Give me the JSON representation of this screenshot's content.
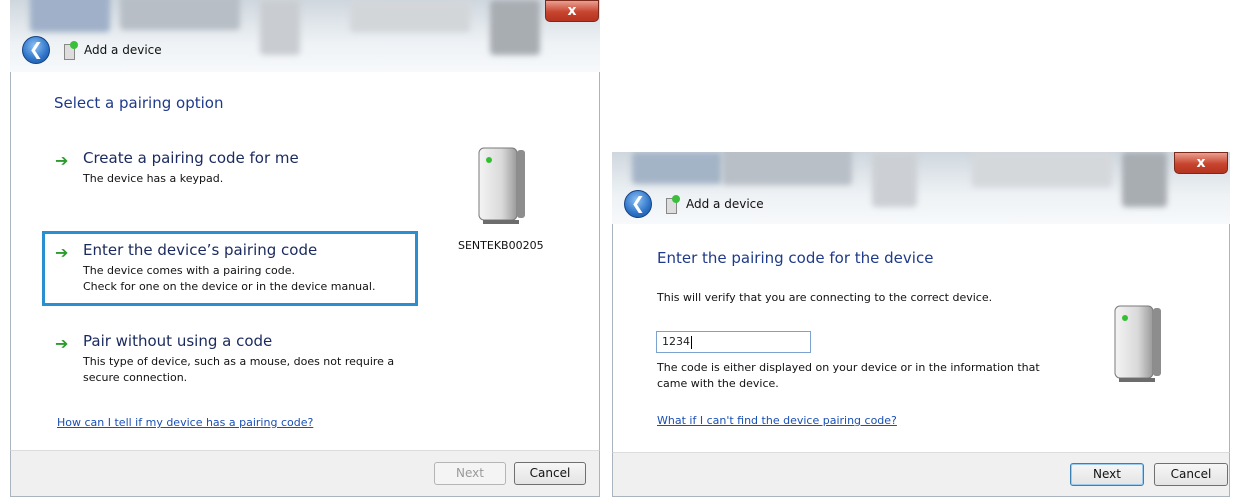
{
  "left_window": {
    "title": "Add a device",
    "close_label": "x",
    "heading": "Select a pairing option",
    "options": [
      {
        "title": "Create a pairing code for me",
        "desc": [
          "The device has a keypad."
        ],
        "selected": false
      },
      {
        "title": "Enter the device’s pairing code",
        "desc": [
          "The device comes with a pairing code.",
          "Check for one on the device or in the device manual."
        ],
        "selected": true
      },
      {
        "title": "Pair without using a code",
        "desc": [
          "This type of device, such as a mouse, does not require a",
          "secure connection."
        ],
        "selected": false
      }
    ],
    "device_name": "SENTEKB00205",
    "help_link": "How can I tell if my device has a pairing code?",
    "next_label": "Next",
    "next_enabled": false,
    "cancel_label": "Cancel"
  },
  "right_window": {
    "title": "Add a device",
    "close_label": "x",
    "heading": "Enter the pairing code for the device",
    "intro": "This will verify that you are connecting to the correct device.",
    "code_value": "1234",
    "hint": [
      "The code is either displayed on your device or in the information that",
      "came with the device."
    ],
    "help_link": "What if I can't find the device pairing code?",
    "next_label": "Next",
    "cancel_label": "Cancel"
  },
  "colors": {
    "heading": "#1f3a8a",
    "link": "#1b4fb3",
    "selection_border": "#2a8fd0",
    "arrow": "#2e9b2e"
  }
}
